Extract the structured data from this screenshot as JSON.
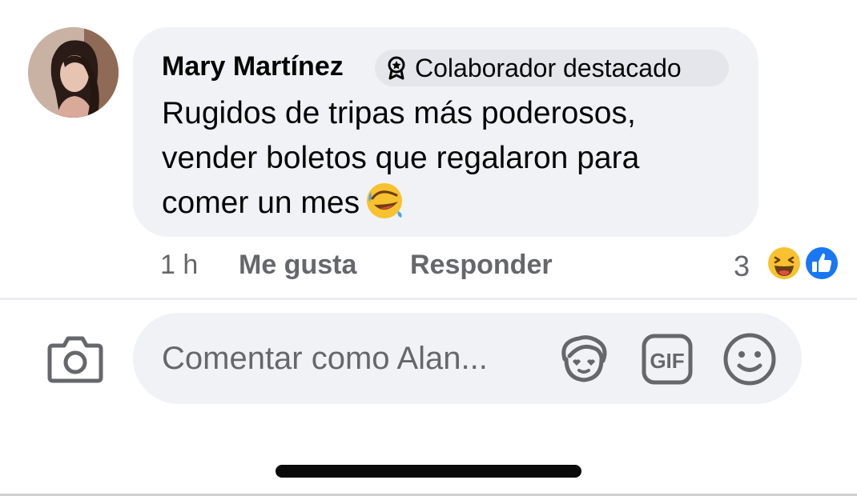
{
  "comment": {
    "author": "Mary Martínez",
    "badge": "Colaborador destacado",
    "lines": [
      "Rugidos de tripas más poderosos,",
      "vender boletos que regalaron para",
      "comer un mes"
    ],
    "emoji": "rolling-on-the-floor-laughing-emoji"
  },
  "actions": {
    "time": "1 h",
    "like_label": "Me gusta",
    "reply_label": "Responder",
    "reaction_count": "3",
    "reactions": [
      "haha",
      "like"
    ]
  },
  "composer": {
    "placeholder": "Comentar como Alan...",
    "icons": [
      "camera-icon",
      "avatar-sticker-icon",
      "gif-icon",
      "emoji-icon"
    ]
  },
  "colors": {
    "bubble": "#f0f2f5",
    "secondary_text": "#65676b",
    "like_blue": "#1877f2"
  }
}
